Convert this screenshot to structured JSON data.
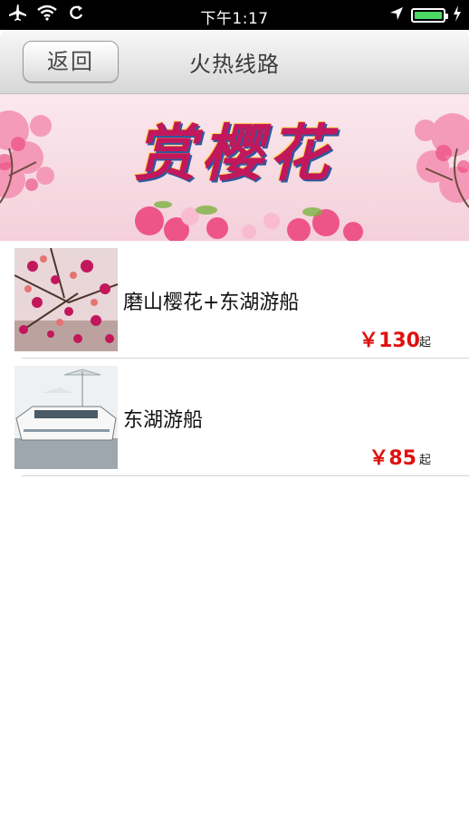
{
  "status_bar": {
    "time": "下午1:17",
    "icons": [
      "airplane-icon",
      "wifi-icon",
      "sync-icon",
      "location-arrow-icon",
      "battery-icon",
      "charging-icon"
    ],
    "battery_color": "#4cd964"
  },
  "nav": {
    "back_label": "返回",
    "title": "火热线路"
  },
  "banner": {
    "title": "赏樱花"
  },
  "routes": [
    {
      "name": "磨山樱花+东湖游船",
      "price": "￥130",
      "suffix": "起"
    },
    {
      "name": "东湖游船",
      "price": "￥85",
      "suffix": "起"
    }
  ],
  "colors": {
    "price": "#e01010",
    "divider": "#d3d3d3"
  }
}
